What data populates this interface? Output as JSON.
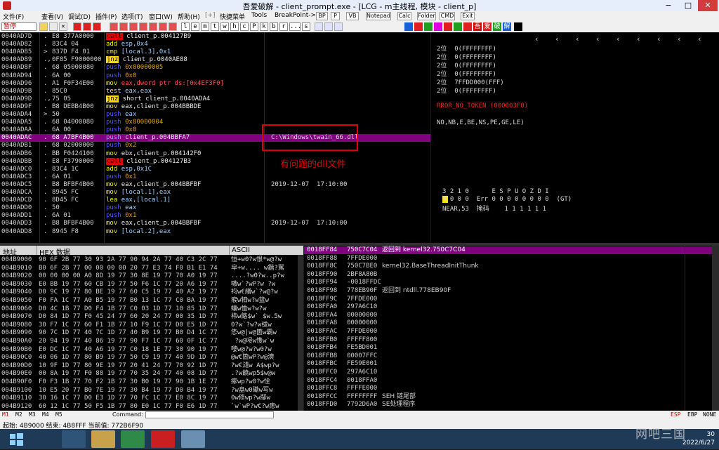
{
  "window": {
    "title": "吾爱破解 - client_prompt.exe - [LCG - m主线程, 模块 - client_p]",
    "min": "−",
    "max": "□",
    "close": "✕"
  },
  "menu": {
    "items": [
      "文件(F)",
      "查看(V)",
      "调试(D)",
      "插件(P)",
      "选项(T)",
      "窗口(W)",
      "帮助(H)",
      "[+]",
      "快捷菜单",
      "Tools",
      "BreakPoint->"
    ],
    "buttons": [
      "BP",
      "P",
      "VB",
      "Notepad",
      "Calc",
      "Folder",
      "CMD",
      "Exit"
    ]
  },
  "toolbar": {
    "state": "暂停",
    "letters": [
      "l",
      "e",
      "m",
      "t",
      "w",
      "h",
      "c",
      "P",
      "k",
      "b",
      "r",
      "...",
      "s"
    ],
    "colors": [
      "#1560d8",
      "#e02020",
      "#20a020",
      "#e000e0",
      "#e02020",
      "#20a020",
      "#e02020",
      "#e00000",
      "#e02020",
      "#20a020"
    ],
    "right_labels": [
      "吾",
      "爱",
      "破",
      "解"
    ]
  },
  "cpu": {
    "selected_index": 13,
    "rows": [
      {
        "addr": "0040AD7D",
        "mark": ".",
        "hex": "E8 377A0000",
        "op": "call",
        "args": "client_p.004127B9",
        "comment": ""
      },
      {
        "addr": "0040AD82",
        "mark": ".",
        "hex": "83C4 04",
        "op": "add",
        "args": "esp,0x4",
        "comment": ""
      },
      {
        "addr": "0040AD85",
        "mark": ">",
        "hex": "837D F4 01",
        "op": "cmp",
        "args": "[local.3],0x1",
        "comment": ""
      },
      {
        "addr": "0040AD89",
        "mark": ".,",
        "hex": "0F85 F9000000",
        "op": "jnz",
        "args": "client_p.0040AE88",
        "comment": ""
      },
      {
        "addr": "0040AD8F",
        "mark": ".",
        "hex": "68 05000080",
        "op": "push",
        "args": "0x80000005",
        "comment": ""
      },
      {
        "addr": "0040AD94",
        "mark": ".",
        "hex": "6A 00",
        "op": "push",
        "args": "0x0",
        "comment": ""
      },
      {
        "addr": "0040AD96",
        "mark": ".",
        "hex": "A1 F0F34E00",
        "op": "mov",
        "args": "eax,dword ptr ds:[0x4EF3F0]",
        "comment": ""
      },
      {
        "addr": "0040AD9B",
        "mark": ".",
        "hex": "85C0",
        "op": "test",
        "args": "eax,eax",
        "comment": ""
      },
      {
        "addr": "0040AD9D",
        "mark": ".,",
        "hex": "75 05",
        "op": "jnz",
        "args": "short client_p.0040ADA4",
        "comment": ""
      },
      {
        "addr": "0040AD9F",
        "mark": ".",
        "hex": "B8 DEBB4B00",
        "op": "mov",
        "args": "eax,client_p.004BBBDE",
        "comment": ""
      },
      {
        "addr": "0040ADA4",
        "mark": ">",
        "hex": "50",
        "op": "push",
        "args": "eax",
        "comment": ""
      },
      {
        "addr": "0040ADA5",
        "mark": ".",
        "hex": "68 04000080",
        "op": "push",
        "args": "0x80000004",
        "comment": ""
      },
      {
        "addr": "0040ADAA",
        "mark": ".",
        "hex": "6A 00",
        "op": "push",
        "args": "0x0",
        "comment": ""
      },
      {
        "addr": "0040ADAC",
        "mark": ".",
        "hex": "68 A7BF4B00",
        "op": "push",
        "args": "client_p.004BBFA7",
        "comment": "C:\\Windows\\twain_66.dll"
      },
      {
        "addr": "0040ADB1",
        "mark": ".",
        "hex": "68 02000000",
        "op": "push",
        "args": "0x2",
        "comment": ""
      },
      {
        "addr": "0040ADB6",
        "mark": ".",
        "hex": "BB F0424100",
        "op": "mov",
        "args": "ebx,client_p.004142F0",
        "comment": ""
      },
      {
        "addr": "0040ADBB",
        "mark": ".",
        "hex": "E8 F3790000",
        "op": "call",
        "args": "client_p.004127B3",
        "comment": ""
      },
      {
        "addr": "0040ADC0",
        "mark": ".",
        "hex": "83C4 1C",
        "op": "add",
        "args": "esp,0x1C",
        "comment": ""
      },
      {
        "addr": "0040ADC3",
        "mark": ".",
        "hex": "6A 01",
        "op": "push",
        "args": "0x1",
        "comment": ""
      },
      {
        "addr": "0040ADC5",
        "mark": ".",
        "hex": "B8 BFBF4B00",
        "op": "mov",
        "args": "eax,client_p.004BBFBF",
        "comment": "2019-12-07  17:10:00"
      },
      {
        "addr": "0040ADCA",
        "mark": ".",
        "hex": "8945 FC",
        "op": "mov",
        "args": "[local.1],eax",
        "comment": ""
      },
      {
        "addr": "0040ADCD",
        "mark": ".",
        "hex": "8D45 FC",
        "op": "lea",
        "args": "eax,[local.1]",
        "comment": ""
      },
      {
        "addr": "0040ADD0",
        "mark": ".",
        "hex": "50",
        "op": "push",
        "args": "eax",
        "comment": ""
      },
      {
        "addr": "0040ADD1",
        "mark": ".",
        "hex": "6A 01",
        "op": "push",
        "args": "0x1",
        "comment": ""
      },
      {
        "addr": "0040ADD3",
        "mark": ".",
        "hex": "B8 BFBF4B00",
        "op": "mov",
        "args": "eax,client_p.004BBFBF",
        "comment": "2019-12-07  17:10:00"
      },
      {
        "addr": "0040ADD8",
        "mark": ".",
        "hex": "8945 F8",
        "op": "mov",
        "args": "[local.2],eax",
        "comment": ""
      }
    ]
  },
  "annotation": "有问题的dll文件",
  "registers": {
    "lines": [
      {
        "text": "2位  0(FFFFFFFF)",
        "err": false
      },
      {
        "text": "2位  0(FFFFFFFF)",
        "err": false
      },
      {
        "text": "2位  0(FFFFFFFF)",
        "err": false
      },
      {
        "text": "2位  0(FFFFFFFF)",
        "err": false
      },
      {
        "text": "2位  7FFDD000(FFF)",
        "err": false
      },
      {
        "text": "2位  0(FFFFFFFF)",
        "err": false
      },
      {
        "text": "",
        "err": false
      },
      {
        "text": "RROR_NO_TOKEN (000003F0)",
        "err": true
      },
      {
        "text": "",
        "err": false
      },
      {
        "text": "NO,NB,E,BE,NS,PE,GE,LE)",
        "err": false
      }
    ],
    "fpu": [
      "3 2 1 0      E S P U O Z D I",
      "0 0 0 0  Err 0 0 0 0 0 0 0 0  (GT)",
      "NEAR,53  掩码    1 1 1 1 1 1"
    ]
  },
  "dump": {
    "headers": [
      "地址",
      "HEX 数据",
      "ASCII"
    ],
    "rows": [
      {
        "addr": "004B9000",
        "hex": "90 6F 2B 77 30 93 2A 77 90 94 2A 77 40 C3 2C 77",
        "ascii": "恒+w0?w恨*w@?w"
      },
      {
        "addr": "004B9010",
        "hex": "B0 6F 2B 77 00 00 00 00 20 77 E3 74 F0 B1 E1 74",
        "ascii": "皁+w.... w鍇?駡"
      },
      {
        "addr": "004B9020",
        "hex": "00 00 00 00 A0 8D 19 77 30 8E 19 77 70 A0 19 77",
        "ascii": "....?w0?w..p?w"
      },
      {
        "addr": "004B9030",
        "hex": "E0 BB 19 77 60 CB 19 77 50 F6 1C 77 20 A6 19 77",
        "ascii": "嗷w`?wP?w ?w"
      },
      {
        "addr": "004B9040",
        "hex": "D0 9C 19 77 80 BE 19 77 60 C5 19 77 40 A2 19 77",
        "ascii": "袀w€緡w`?w@?w"
      },
      {
        "addr": "004B9050",
        "hex": "F0 FA 1C 77 A0 B5 19 77 B0 13 1C 77 C0 BA 19 77",
        "ascii": "瘊w牭w?w篮w"
      },
      {
        "addr": "004B9060",
        "hex": "D0 4C 1B 77 D0 F4 1B 77 C0 03 1D 77 10 85 1D 77",
        "ascii": "蠰w恤w?w?w"
      },
      {
        "addr": "004B9070",
        "hex": "D0 84 1D 77 F0 45 24 77 60 20 24 77 00 35 1D 77",
        "ascii": "袆w餎$w` $w.5w"
      },
      {
        "addr": "004B9080",
        "hex": "30 F7 1C 77 60 F1 1B 77 10 F9 1C 77 D0 E5 1D 77",
        "ascii": "0?w`?w?w绂w"
      },
      {
        "addr": "004B9090",
        "hex": "90 7C 1D 77 40 7C 1D 77 40 B9 19 77 B0 D4 1C 77",
        "ascii": "恷w@|w@箇w霸w"
      },
      {
        "addr": "004B90A0",
        "hex": "20 94 19 77 40 86 19 77 90 F7 1C 77 60 0F 1C 77",
        "ascii": " ?w@唚w愯w`w"
      },
      {
        "addr": "004B90B0",
        "hex": "E0 DC 1C 77 40 A6 19 77 C0 18 1E 77 30 90 19 77",
        "ascii": "嘙w@?w?w0?w"
      },
      {
        "addr": "004B90C0",
        "hex": "40 06 1D 77 80 B9 19 77 50 C9 19 77 40 9D 1D 77",
        "ascii": "@w€箇wP?w@漺"
      },
      {
        "addr": "004B90D0",
        "hex": "10 9F 1D 77 80 9E 19 77 20 41 24 77 70 92 1D 77",
        "ascii": "?w€瀢w A$wp?w"
      },
      {
        "addr": "004B90E0",
        "hex": "00 8A 19 77 F0 88 19 77 70 35 24 77 40 08 1D 77",
        "ascii": ".?w饒wp5$w@w"
      },
      {
        "addr": "004B90F0",
        "hex": "F0 F3 1B 77 70 F2 1B 77 30 B0 19 77 90 1B 1E 77",
        "ascii": "瘃wp?w0?w恮"
      },
      {
        "addr": "004B9100",
        "hex": "10 E5 20 77 B0 7E 19 77 30 B4 19 77 D0 B4 19 77",
        "ascii": "?w皛w0磡w写w"
      },
      {
        "addr": "004B9110",
        "hex": "30 16 1C 77 D0 E3 1D 77 70 FC 1C 77 E0 8C 19 77",
        "ascii": "0w修wp?w鄬w"
      },
      {
        "addr": "004B9120",
        "hex": "60 12 1C 77 50 F5 1B 77 80 E0 1C 77 F0 E6 1D 77",
        "ascii": "`w`wP?w€?w痣w"
      }
    ]
  },
  "stack": {
    "rows": [
      {
        "addr": "0018FF84",
        "val": "750C7C04",
        "com": "返回到 kernel32.750C7C04"
      },
      {
        "addr": "0018FF88",
        "val": "7FFDE000",
        "com": ""
      },
      {
        "addr": "0018FF8C",
        "val": "750C7BE0",
        "com": "kernel32.BaseThreadInitThunk"
      },
      {
        "addr": "0018FF90",
        "val": "2BF8A80B",
        "com": ""
      },
      {
        "addr": "0018FF94",
        "val": "-0018FFDC",
        "com": ""
      },
      {
        "addr": "0018FF98",
        "val": "778EB90F",
        "com": "返回到 ntdll.778EB90F"
      },
      {
        "addr": "0018FF9C",
        "val": "7FFDE000",
        "com": ""
      },
      {
        "addr": "0018FFA0",
        "val": "297A6C10",
        "com": ""
      },
      {
        "addr": "0018FFA4",
        "val": "00000000",
        "com": ""
      },
      {
        "addr": "0018FFA8",
        "val": "00000000",
        "com": ""
      },
      {
        "addr": "0018FFAC",
        "val": "7FFDE000",
        "com": ""
      },
      {
        "addr": "0018FFB0",
        "val": "FFFFF800",
        "com": ""
      },
      {
        "addr": "0018FFB4",
        "val": "FE5BD001",
        "com": ""
      },
      {
        "addr": "0018FFB8",
        "val": "00007FFC",
        "com": ""
      },
      {
        "addr": "0018FFBC",
        "val": "FE59E001",
        "com": ""
      },
      {
        "addr": "0018FFC0",
        "val": "297A6C10",
        "com": ""
      },
      {
        "addr": "0018FFC4",
        "val": "0018FFA0",
        "com": ""
      },
      {
        "addr": "0018FFC8",
        "val": "FFFFE000",
        "com": ""
      },
      {
        "addr": "0018FFCC",
        "val": "FFFFFFFF",
        "com": "SEH 链尾部"
      },
      {
        "addr": "0018FFD0",
        "val": "7792D6A0",
        "com": "SE处理程序"
      }
    ]
  },
  "bottom": {
    "tabs": [
      "M1",
      "M2",
      "M3",
      "M4",
      "M5"
    ],
    "command_label": "Command:",
    "right": [
      "ESP",
      "EBP",
      "NONE"
    ],
    "status": "起始: 4B9000  结束: 4B8FFF  当前值: 772B6F90"
  },
  "taskbar": {
    "time": "30",
    "date": "2022/6/27",
    "watermark": "网吧三国"
  }
}
